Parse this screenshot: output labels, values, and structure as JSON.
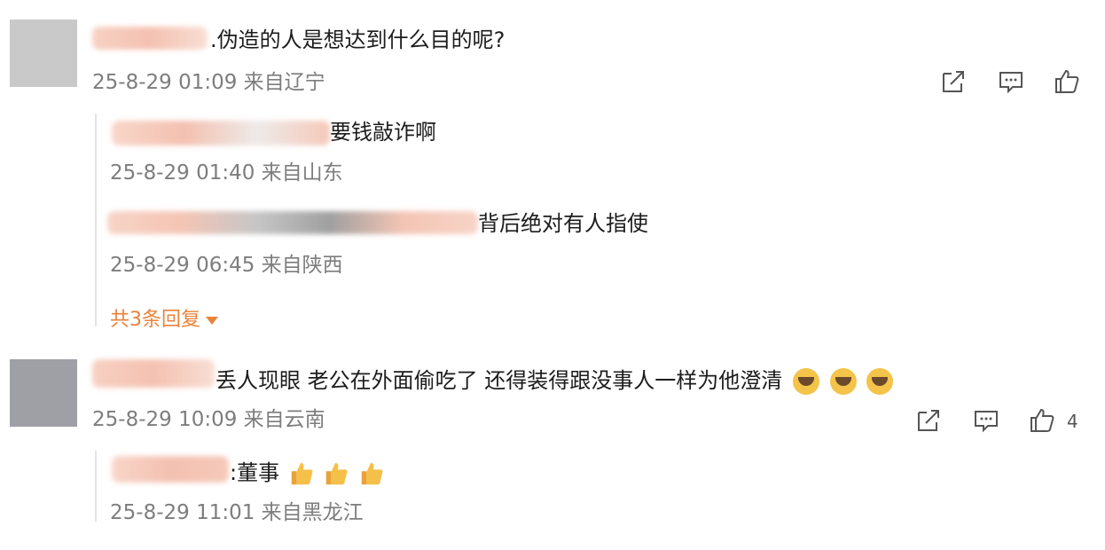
{
  "comments": [
    {
      "text": ".伪造的人是想达到什么目的呢?",
      "meta": "25-8-29 01:09 来自辽宁",
      "replies": [
        {
          "text": "要钱敲诈啊",
          "meta": "25-8-29 01:40 来自山东"
        },
        {
          "text": "背后绝对有人指使",
          "meta": "25-8-29 06:45 来自陕西"
        }
      ],
      "more_replies": "共3条回复"
    },
    {
      "text": "丢人现眼 老公在外面偷吃了 还得装得跟没事人一样为他澄清",
      "meta": "25-8-29 10:09 来自云南",
      "like_count": "4",
      "emoji": [
        "crying-laughing-emoji",
        "crying-laughing-emoji",
        "crying-laughing-emoji"
      ],
      "replies": [
        {
          "text": ":董事",
          "meta": "25-8-29 11:01 来自黑龙江",
          "emoji": [
            "thumbs-up-emoji",
            "thumbs-up-emoji",
            "thumbs-up-emoji"
          ]
        }
      ]
    }
  ],
  "icons": {
    "share": "share-icon",
    "comment": "comment-icon",
    "like": "thumbs-up-icon"
  },
  "colors": {
    "accent": "#e8833a",
    "meta": "#7d7d7d",
    "text": "#1c1c1c"
  }
}
